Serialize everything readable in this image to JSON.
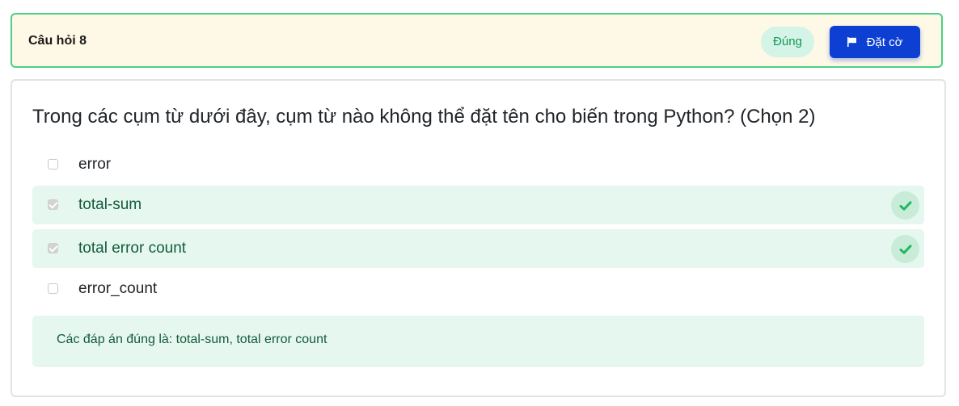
{
  "header": {
    "title": "Câu hỏi 8",
    "status": "Đúng",
    "flag_label": "Đặt cờ",
    "flag_icon": "flag-icon"
  },
  "question": {
    "text": "Trong các cụm từ dưới đây, cụm từ nào không thể đặt tên cho biến trong Python? (Chọn 2)",
    "options": [
      {
        "label": "error",
        "checked": false,
        "correct": false
      },
      {
        "label": "total-sum",
        "checked": true,
        "correct": true
      },
      {
        "label": "total error count",
        "checked": true,
        "correct": true
      },
      {
        "label": "error_count",
        "checked": false,
        "correct": false
      }
    ],
    "answer_text": "Các đáp án đúng là: total-sum, total error count"
  },
  "colors": {
    "header_border": "#4ccf88",
    "header_background": "#fef8e6",
    "flag_button": "#0d3fd3",
    "correct_background": "#e6f7ef",
    "correct_text": "#135c3e",
    "check_icon": "#1fb864"
  }
}
